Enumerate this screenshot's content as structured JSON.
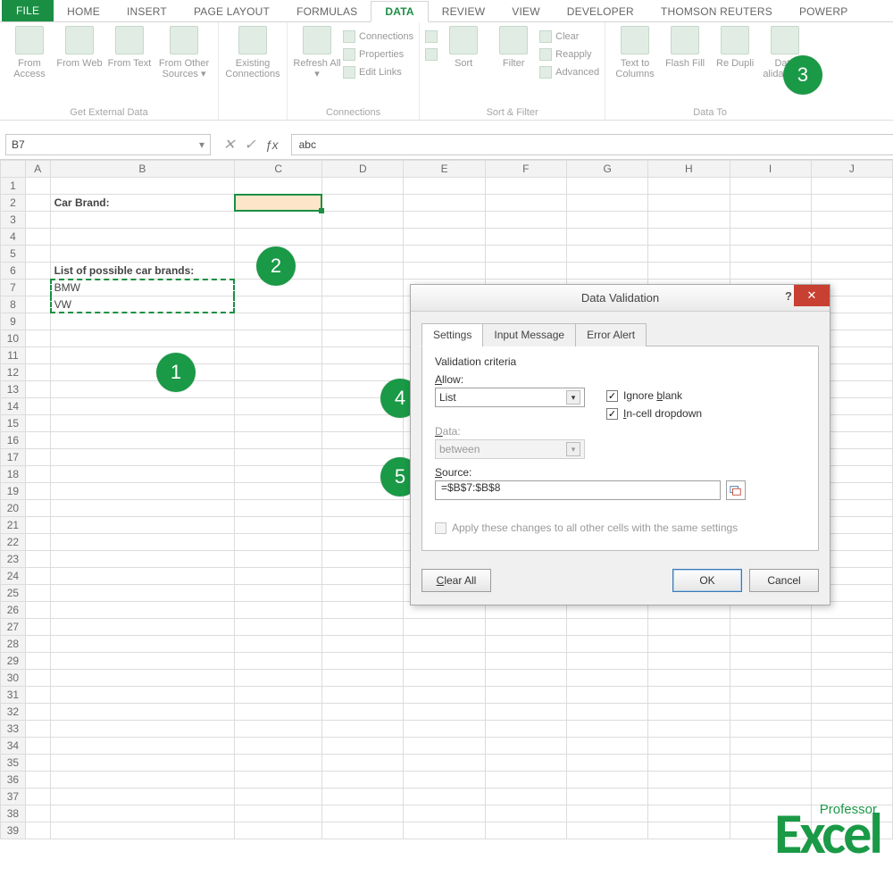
{
  "tabs": {
    "file": "FILE",
    "home": "HOME",
    "insert": "INSERT",
    "page_layout": "PAGE LAYOUT",
    "formulas": "FORMULAS",
    "data": "DATA",
    "review": "REVIEW",
    "view": "VIEW",
    "developer": "DEVELOPER",
    "thomson": "THOMSON REUTERS",
    "powerp": "POWERP"
  },
  "ribbon": {
    "get_data": {
      "label": "Get External Data",
      "access": "From Access",
      "web": "From Web",
      "text": "From Text",
      "other": "From Other Sources ▾"
    },
    "exist": {
      "label": "Existing Connections"
    },
    "conn": {
      "label": "Connections",
      "refresh": "Refresh All ▾",
      "connections": "Connections",
      "properties": "Properties",
      "edit_links": "Edit Links"
    },
    "sortfilter": {
      "label": "Sort & Filter",
      "sort": "Sort",
      "filter": "Filter",
      "clear": "Clear",
      "reapply": "Reapply",
      "advanced": "Advanced"
    },
    "datatools": {
      "label": "Data To",
      "ttc": "Text to Columns",
      "flash": "Flash Fill",
      "dup": "Re Dupli",
      "valid": "Data alidation ▾"
    }
  },
  "namebox": "B7",
  "formula": "abc",
  "cols": [
    "A",
    "B",
    "C",
    "D",
    "E",
    "F",
    "G",
    "H",
    "I",
    "J"
  ],
  "cells": {
    "B2": "Car Brand:",
    "B6": "List of possible car brands:",
    "B7": "BMW",
    "B8": "VW"
  },
  "callouts": {
    "c1": "1",
    "c2": "2",
    "c3": "3",
    "c4": "4",
    "c5": "5"
  },
  "dialog": {
    "title": "Data Validation",
    "tabs": {
      "settings": "Settings",
      "input": "Input Message",
      "error": "Error Alert"
    },
    "vc": "Validation criteria",
    "allow_lbl": "Allow:",
    "allow_val": "List",
    "ignore": "Ignore blank",
    "incell": "In-cell dropdown",
    "data_lbl": "Data:",
    "data_val": "between",
    "source_lbl": "Source:",
    "source_val": "=$B$7:$B$8",
    "apply": "Apply these changes to all other cells with the same settings",
    "clear": "Clear All",
    "ok": "OK",
    "cancel": "Cancel"
  },
  "logo": {
    "big": "Excel",
    "small": "Professor"
  }
}
